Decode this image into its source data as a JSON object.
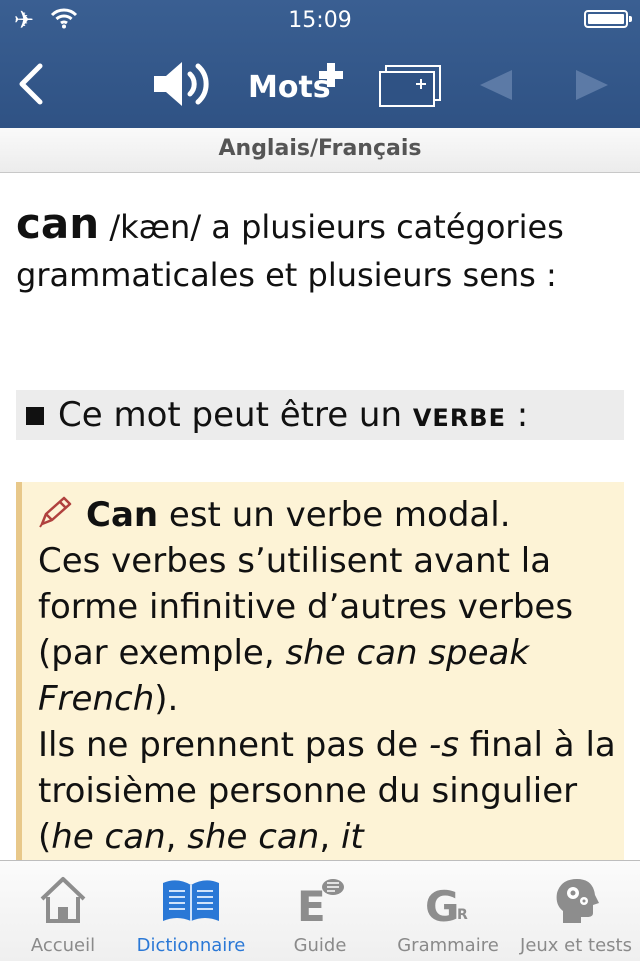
{
  "status_bar": {
    "time": "15:09"
  },
  "nav": {
    "mots_label": "Mots"
  },
  "subheader": {
    "title": "Anglais/Français"
  },
  "entry": {
    "word": "can",
    "phonetic": "/kæn/",
    "intro_text": "a plusieurs catégories grammaticales et plusieurs sens :",
    "category_prefix": "Ce mot peut être un",
    "category": "VERBE",
    "category_suffix": ":"
  },
  "note": {
    "word": "Can",
    "line1": "est un verbe modal.",
    "text_a": "Ces verbes s’utilisent avant la forme infinitive d’autres verbes (par exemple, ",
    "example1": "she can speak French",
    "text_b": ").",
    "text_c": "Ils ne prennent pas de ",
    "suffix": "-s",
    "text_d": " final à la troisième personne du singulier (",
    "ex_a": "he can",
    "sep1": ", ",
    "ex_b": "she can",
    "sep2": ", ",
    "ex_c": "it"
  },
  "tabs": [
    {
      "label": "Accueil",
      "icon": "home-icon"
    },
    {
      "label": "Dictionnaire",
      "icon": "dictionary-icon",
      "active": true
    },
    {
      "label": "Guide",
      "icon": "guide-icon"
    },
    {
      "label": "Grammaire",
      "icon": "grammar-icon"
    },
    {
      "label": "Jeux et tests",
      "icon": "games-icon"
    }
  ],
  "colors": {
    "nav_bg": "#2f5284",
    "note_bg": "#fdf3d6",
    "active_tab": "#2a78d6"
  }
}
